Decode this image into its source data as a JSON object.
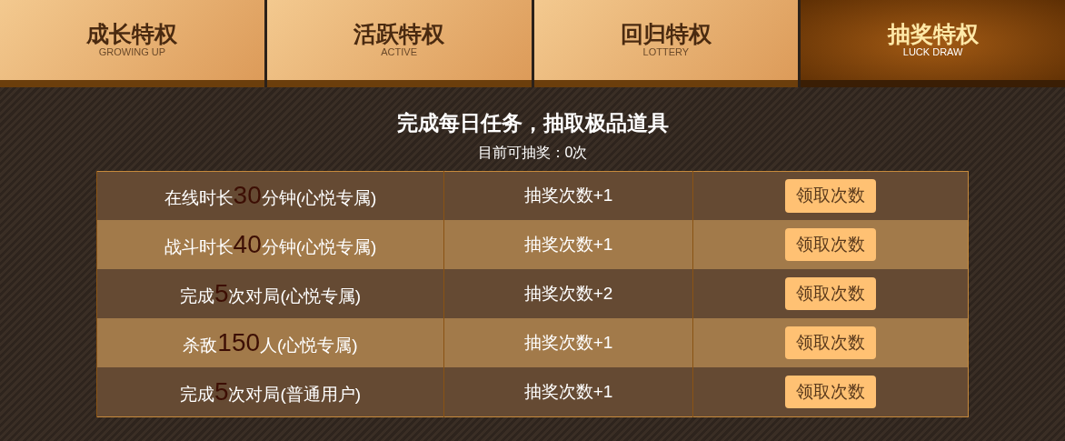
{
  "tabs": [
    {
      "title": "成长特权",
      "subtitle": "GROWING UP",
      "selected": false
    },
    {
      "title": "活跃特权",
      "subtitle": "ACTIVE",
      "selected": false
    },
    {
      "title": "回归特权",
      "subtitle": "LOTTERY",
      "selected": false
    },
    {
      "title": "抽奖特权",
      "subtitle": "LUCK DRAW",
      "selected": true
    }
  ],
  "heading": "完成每日任务，抽取极品道具",
  "draws_left": "目前可抽奖：0次",
  "tasks": [
    {
      "prefix": "在线时长",
      "number": "30",
      "suffix": "分钟(心悦专属)",
      "reward": "抽奖次数+1",
      "button": "领取次数"
    },
    {
      "prefix": "战斗时长",
      "number": "40",
      "suffix": "分钟(心悦专属)",
      "reward": "抽奖次数+1",
      "button": "领取次数"
    },
    {
      "prefix": "完成",
      "number": "5",
      "suffix": "次对局(心悦专属)",
      "reward": "抽奖次数+2",
      "button": "领取次数"
    },
    {
      "prefix": "杀敌",
      "number": "150",
      "suffix": "人(心悦专属)",
      "reward": "抽奖次数+1",
      "button": "领取次数"
    },
    {
      "prefix": "完成",
      "number": "5",
      "suffix": "次对局(普通用户)",
      "reward": "抽奖次数+1",
      "button": "领取次数"
    }
  ]
}
